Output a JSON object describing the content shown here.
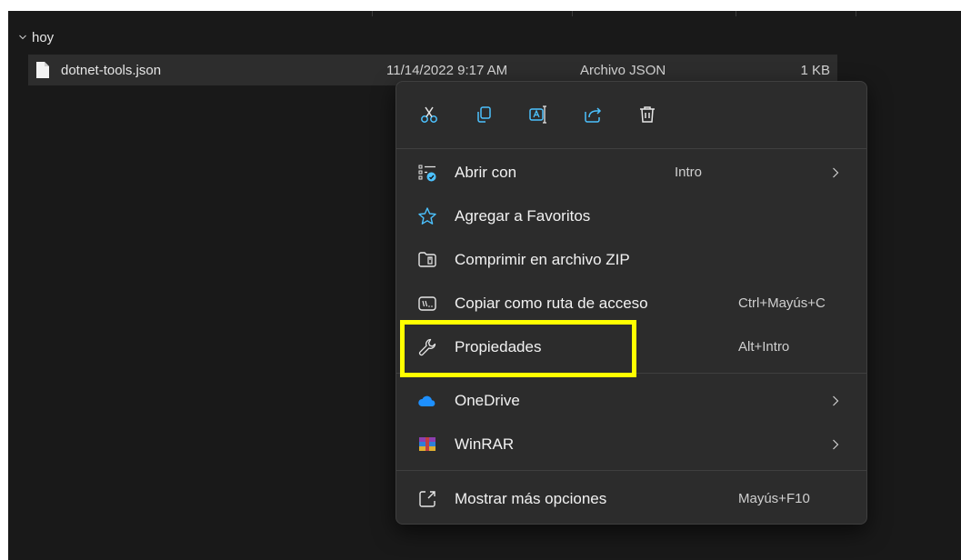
{
  "group": {
    "label": "hoy"
  },
  "file": {
    "name": "dotnet-tools.json",
    "date": "11/14/2022 9:17 AM",
    "type": "Archivo JSON",
    "size": "1 KB"
  },
  "quick_actions": [
    {
      "icon": "cut-icon"
    },
    {
      "icon": "copy-icon"
    },
    {
      "icon": "rename-icon"
    },
    {
      "icon": "share-icon"
    },
    {
      "icon": "delete-icon"
    }
  ],
  "menu": {
    "open_with": {
      "label": "Abrir con",
      "shortcut": "Intro"
    },
    "favorites": {
      "label": "Agregar a Favoritos"
    },
    "zip": {
      "label": "Comprimir en archivo ZIP"
    },
    "copy_path": {
      "label": "Copiar como ruta de acceso",
      "shortcut": "Ctrl+Mayús+C"
    },
    "properties": {
      "label": "Propiedades",
      "shortcut": "Alt+Intro"
    },
    "onedrive": {
      "label": "OneDrive"
    },
    "winrar": {
      "label": "WinRAR"
    },
    "more_options": {
      "label": "Mostrar más opciones",
      "shortcut": "Mayús+F10"
    }
  },
  "colors": {
    "background": "#191919",
    "selected_row": "#2d2d2d",
    "menu": "#2c2c2c",
    "accent_blue": "#4cc2ff",
    "highlight": "#ffff00"
  }
}
